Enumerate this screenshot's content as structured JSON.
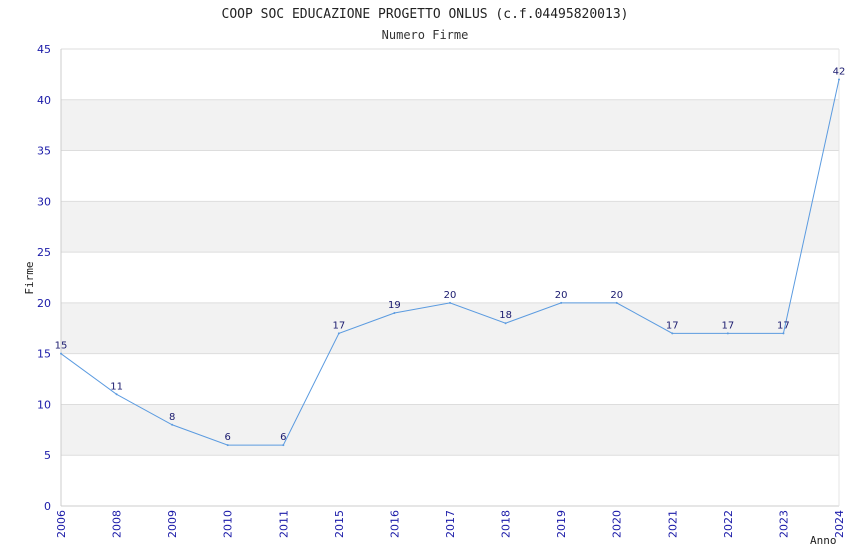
{
  "chart_data": {
    "type": "line",
    "title": "COOP SOC EDUCAZIONE PROGETTO ONLUS (c.f.04495820013)",
    "subtitle": "Numero Firme",
    "xlabel": "Anno",
    "ylabel": "Firme",
    "ylim": [
      0,
      45
    ],
    "yticks": [
      "0",
      "5",
      "10",
      "15",
      "20",
      "25",
      "30",
      "35",
      "40",
      "45"
    ],
    "categories": [
      "2006",
      "2008",
      "2009",
      "2010",
      "2011",
      "2015",
      "2016",
      "2017",
      "2018",
      "2019",
      "2020",
      "2021",
      "2022",
      "2023",
      "2024"
    ],
    "series": [
      {
        "values": [
          15,
          11,
          8,
          6,
          6,
          17,
          19,
          20,
          18,
          20,
          20,
          17,
          17,
          17,
          42
        ]
      }
    ],
    "grid": "horizontal bands",
    "colors": {
      "line": "#5b9be0",
      "band": "#f2f2f2",
      "grid": "#dddddd",
      "tick": "#1a1aa8"
    }
  }
}
